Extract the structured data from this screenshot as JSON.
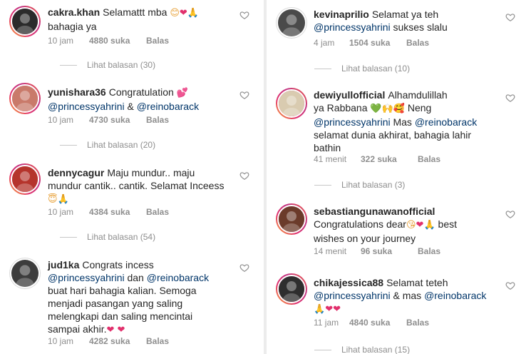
{
  "labels": {
    "likes_suffix": "suka",
    "reply": "Balas"
  },
  "left": [
    {
      "username": "cakra.khan",
      "segments": [
        {
          "t": "text",
          "v": "Selamattt mba "
        },
        {
          "t": "emoji",
          "v": "😊"
        },
        {
          "t": "emoji-pink",
          "v": "❤"
        },
        {
          "t": "emoji",
          "v": "🙏"
        },
        {
          "t": "br"
        },
        {
          "t": "text",
          "v": "bahagia ya"
        }
      ],
      "time": "10 jam",
      "likes": "4880",
      "view_replies": "Lihat balasan (30)",
      "avatar_color": "#2b2b2b",
      "story_ring": true
    },
    {
      "username": "yunishara36",
      "segments": [
        {
          "t": "text",
          "v": "Congratulation "
        },
        {
          "t": "emoji-pink",
          "v": "💕"
        },
        {
          "t": "br"
        },
        {
          "t": "mention",
          "v": "@princessyahrini"
        },
        {
          "t": "text",
          "v": " & "
        },
        {
          "t": "mention",
          "v": "@reinobarack"
        }
      ],
      "time": "10 jam",
      "likes": "4730",
      "view_replies": "Lihat balasan (20)",
      "avatar_color": "#c97a6a",
      "story_ring": true
    },
    {
      "username": "dennycagur",
      "segments": [
        {
          "t": "text",
          "v": "Maju mundur.. maju"
        },
        {
          "t": "br"
        },
        {
          "t": "text",
          "v": "mundur cantik.. cantik. Selamat Inceess"
        },
        {
          "t": "br"
        },
        {
          "t": "emoji",
          "v": "😇🙏"
        }
      ],
      "time": "10 jam",
      "likes": "4384",
      "view_replies": "Lihat balasan (54)",
      "avatar_color": "#b5342c",
      "story_ring": true
    },
    {
      "username": "jud1ka",
      "segments": [
        {
          "t": "text",
          "v": "Congrats incess"
        },
        {
          "t": "br"
        },
        {
          "t": "mention",
          "v": "@princessyahrini"
        },
        {
          "t": "text",
          "v": " dan "
        },
        {
          "t": "mention",
          "v": "@reinobarack"
        },
        {
          "t": "br"
        },
        {
          "t": "text",
          "v": "buat hari bahagia kalian. Semoga"
        },
        {
          "t": "br"
        },
        {
          "t": "text",
          "v": "menjadi pasangan yang saling"
        },
        {
          "t": "br"
        },
        {
          "t": "text",
          "v": "melengkapi dan saling mencintai"
        },
        {
          "t": "br"
        },
        {
          "t": "text",
          "v": "sampai akhir."
        },
        {
          "t": "emoji-pink",
          "v": "❤ ❤"
        }
      ],
      "time": "10 jam",
      "likes": "4282",
      "view_replies": "",
      "avatar_color": "#3d3d3d",
      "story_ring": false
    }
  ],
  "right": [
    {
      "username": "kevinaprilio",
      "segments": [
        {
          "t": "text",
          "v": "Selamat ya teh"
        },
        {
          "t": "br"
        },
        {
          "t": "mention",
          "v": "@princessyahrini"
        },
        {
          "t": "text",
          "v": " sukses slalu"
        }
      ],
      "time": "4 jam",
      "likes": "1504",
      "view_replies": "Lihat balasan (10)",
      "avatar_color": "#4a4a4a",
      "story_ring": false
    },
    {
      "username": "dewiyullofficial",
      "segments": [
        {
          "t": "text",
          "v": "Alhamdulillah"
        },
        {
          "t": "br"
        },
        {
          "t": "text",
          "v": "ya Rabbana "
        },
        {
          "t": "emoji-green",
          "v": "💚"
        },
        {
          "t": "emoji",
          "v": "🙌🥰"
        },
        {
          "t": "text",
          "v": " Neng"
        },
        {
          "t": "br"
        },
        {
          "t": "mention",
          "v": "@princessyahrini"
        },
        {
          "t": "text",
          "v": " Mas "
        },
        {
          "t": "mention",
          "v": "@reinobarack"
        },
        {
          "t": "br"
        },
        {
          "t": "text",
          "v": "selamat dunia akhirat, bahagia lahir"
        },
        {
          "t": "br"
        },
        {
          "t": "text",
          "v": "bathin"
        }
      ],
      "time": "41 menit",
      "likes": "322",
      "view_replies": "Lihat balasan (3)",
      "avatar_color": "#d9cbb0",
      "story_ring": true
    },
    {
      "username": "sebastiangunawanofficial",
      "segments": [
        {
          "t": "br"
        },
        {
          "t": "text",
          "v": "Congratulations dear"
        },
        {
          "t": "emoji",
          "v": "😘"
        },
        {
          "t": "emoji-pink",
          "v": "❤"
        },
        {
          "t": "emoji",
          "v": "🙏"
        },
        {
          "t": "text",
          "v": " best"
        },
        {
          "t": "br"
        },
        {
          "t": "text",
          "v": "wishes on your journey"
        }
      ],
      "time": "14 menit",
      "likes": "96",
      "view_replies": "",
      "avatar_color": "#6b3b2a",
      "story_ring": true
    },
    {
      "username": "chikajessica88",
      "segments": [
        {
          "t": "text",
          "v": "Selamat teteh"
        },
        {
          "t": "br"
        },
        {
          "t": "mention",
          "v": "@princessyahrini"
        },
        {
          "t": "text",
          "v": " & mas "
        },
        {
          "t": "mention",
          "v": "@reinobarack"
        },
        {
          "t": "br"
        },
        {
          "t": "emoji",
          "v": "🙏"
        },
        {
          "t": "emoji-pink",
          "v": "❤❤"
        }
      ],
      "time": "11 jam",
      "likes": "4840",
      "view_replies": "Lihat balasan (15)",
      "avatar_color": "#2e2e2e",
      "story_ring": true
    }
  ]
}
